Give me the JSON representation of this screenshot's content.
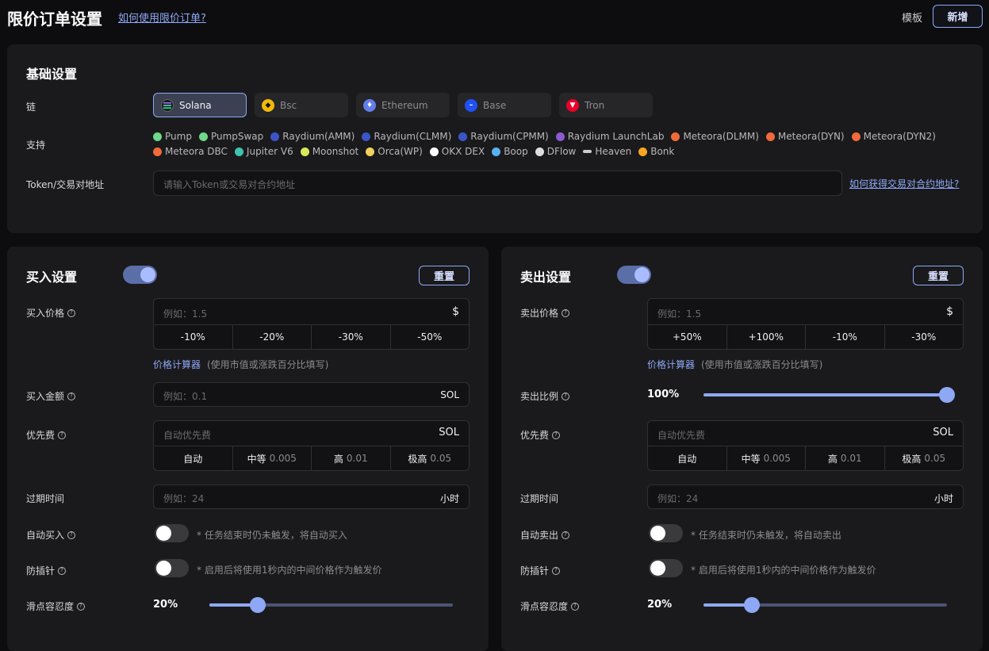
{
  "header": {
    "title": "限价订单设置",
    "help_link": "如何使用限价订单?",
    "template": "模板",
    "new_button": "新增"
  },
  "basic": {
    "title": "基础设置",
    "chain_label": "链",
    "chains": [
      {
        "label": "Solana",
        "icon": "solana-icon",
        "color": "#1a1a1a",
        "selected": true
      },
      {
        "label": "Bsc",
        "icon": "bsc-icon",
        "color": "#f0b90b",
        "selected": false
      },
      {
        "label": "Ethereum",
        "icon": "ethereum-icon",
        "color": "#627eea",
        "selected": false
      },
      {
        "label": "Base",
        "icon": "base-icon",
        "color": "#2151f5",
        "selected": false
      },
      {
        "label": "Tron",
        "icon": "tron-icon",
        "color": "#eb0029",
        "selected": false
      }
    ],
    "support_label": "支持",
    "dex_row1": [
      {
        "label": "Pump",
        "color": "#6fd88a"
      },
      {
        "label": "PumpSwap",
        "color": "#6fd88a"
      },
      {
        "label": "Raydium(AMM)",
        "color": "#3b55c8"
      },
      {
        "label": "Raydium(CLMM)",
        "color": "#3b55c8"
      },
      {
        "label": "Raydium(CPMM)",
        "color": "#3b55c8"
      },
      {
        "label": "Raydium LaunchLab",
        "color": "#8a5cd0"
      },
      {
        "label": "Meteora(DLMM)",
        "color": "#f06a3a"
      },
      {
        "label": "Meteora(DYN)",
        "color": "#f06a3a"
      },
      {
        "label": "Meteora(DYN2)",
        "color": "#f06a3a"
      }
    ],
    "dex_row2": [
      {
        "label": "Meteora DBC",
        "color": "#f06a3a"
      },
      {
        "label": "Jupiter V6",
        "color": "#3fc3b0"
      },
      {
        "label": "Moonshot",
        "color": "#d8e85a"
      },
      {
        "label": "Orca(WP)",
        "color": "#f0d060"
      },
      {
        "label": "OKX DEX",
        "color": "#ffffff"
      },
      {
        "label": "Boop",
        "color": "#5ab0f0"
      },
      {
        "label": "DFlow",
        "color": "#dddddd"
      },
      {
        "label": "Heaven",
        "color": "#cccccc"
      },
      {
        "label": "Bonk",
        "color": "#f5a623"
      }
    ],
    "token_label": "Token/交易对地址",
    "token_placeholder": "请输入Token或交易对合约地址",
    "token_help": "如何获得交易对合约地址?"
  },
  "buy": {
    "title": "买入设置",
    "enabled": true,
    "reset": "重置",
    "price_label": "买入价格",
    "price_placeholder": "例如：1.5",
    "price_suffix": "$",
    "price_presets": [
      "-10%",
      "-20%",
      "-30%",
      "-50%"
    ],
    "calc_link": "价格计算器",
    "calc_note": "(使用市值或涨跌百分比填写)",
    "amount_label": "买入金额",
    "amount_placeholder": "例如：0.1",
    "amount_suffix": "SOL",
    "fee_label": "优先费",
    "fee_placeholder": "自动优先费",
    "fee_suffix": "SOL",
    "fee_options": [
      {
        "label": "自动",
        "value": ""
      },
      {
        "label": "中等",
        "value": "0.005"
      },
      {
        "label": "高",
        "value": "0.01"
      },
      {
        "label": "极高",
        "value": "0.05"
      }
    ],
    "expire_label": "过期时间",
    "expire_placeholder": "例如：24",
    "expire_suffix": "小时",
    "auto_label": "自动买入",
    "auto_note": "* 任务结束时仍未触发，将自动买入",
    "auto_enabled": false,
    "antipin_label": "防插针",
    "antipin_note": "* 启用后将使用1秒内的中间价格作为触发价",
    "antipin_enabled": false,
    "slippage_label": "滑点容忍度",
    "slippage_value": "20%",
    "slippage_fraction": 0.2
  },
  "sell": {
    "title": "卖出设置",
    "enabled": true,
    "reset": "重置",
    "price_label": "卖出价格",
    "price_placeholder": "例如：1.5",
    "price_suffix": "$",
    "price_presets": [
      "+50%",
      "+100%",
      "-10%",
      "-30%"
    ],
    "calc_link": "价格计算器",
    "calc_note": "(使用市值或涨跌百分比填写)",
    "ratio_label": "卖出比例",
    "ratio_value": "100%",
    "ratio_fraction": 1.0,
    "fee_label": "优先费",
    "fee_placeholder": "自动优先费",
    "fee_suffix": "SOL",
    "fee_options": [
      {
        "label": "自动",
        "value": ""
      },
      {
        "label": "中等",
        "value": "0.005"
      },
      {
        "label": "高",
        "value": "0.01"
      },
      {
        "label": "极高",
        "value": "0.05"
      }
    ],
    "expire_label": "过期时间",
    "expire_placeholder": "例如：24",
    "expire_suffix": "小时",
    "auto_label": "自动卖出",
    "auto_note": "* 任务结束时仍未触发，将自动卖出",
    "auto_enabled": false,
    "antipin_label": "防插针",
    "antipin_note": "* 启用后将使用1秒内的中间价格作为触发价",
    "antipin_enabled": false,
    "slippage_label": "滑点容忍度",
    "slippage_value": "20%",
    "slippage_fraction": 0.2
  }
}
